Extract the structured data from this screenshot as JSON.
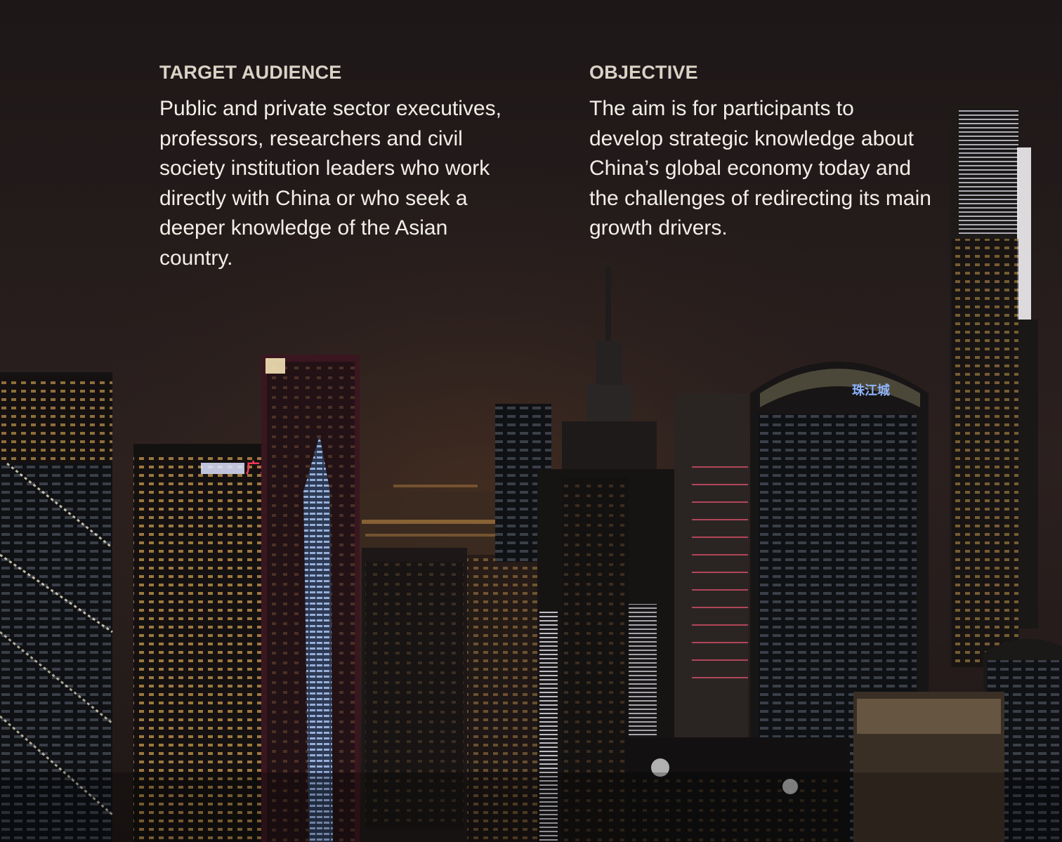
{
  "sections": {
    "audience": {
      "heading": "TARGET AUDIENCE",
      "body": "Public and private sector executives, professors, researchers and civil society institution leaders who work directly with China or who seek a deeper knowledge of the Asian country."
    },
    "objective": {
      "heading": "OBJECTIVE",
      "body": "The aim is for participants to develop strategic knowledge about China’s global economy today and the challenges of redirecting its main growth drivers."
    }
  },
  "background": {
    "sign_left": "广州银行",
    "sign_right": "珠江城"
  },
  "colors": {
    "heading": "#d9d2c6",
    "body": "#f3efe8",
    "background": "#1c1616"
  }
}
